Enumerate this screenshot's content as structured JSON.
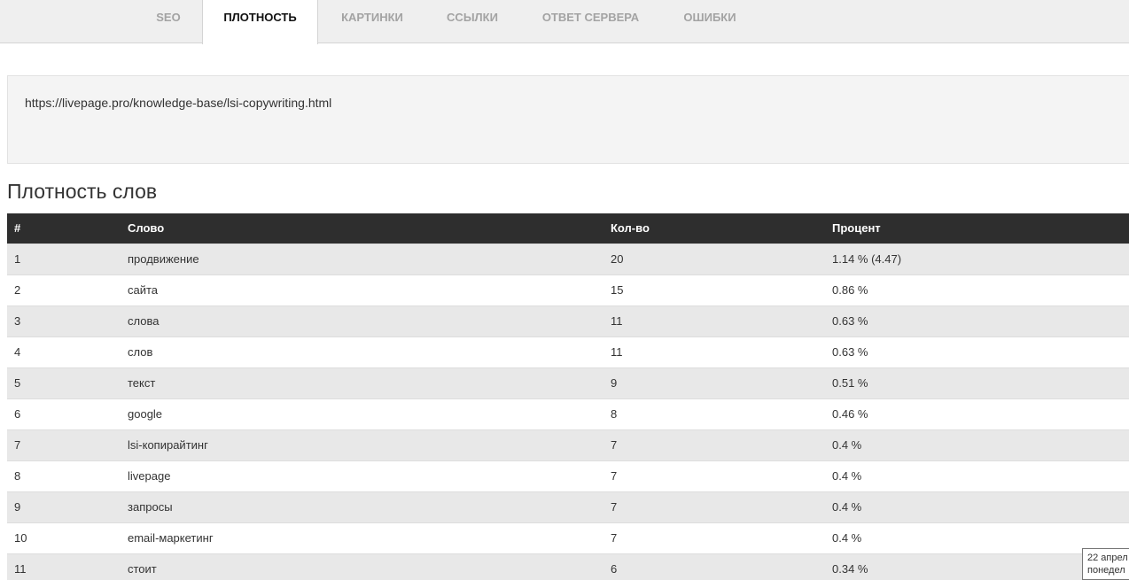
{
  "tabs": [
    {
      "label": "SEO",
      "active": false
    },
    {
      "label": "ПЛОТНОСТЬ",
      "active": true
    },
    {
      "label": "КАРТИНКИ",
      "active": false
    },
    {
      "label": "ССЫЛКИ",
      "active": false
    },
    {
      "label": "ОТВЕТ СЕРВЕРА",
      "active": false
    },
    {
      "label": "ОШИБКИ",
      "active": false
    }
  ],
  "url": "https://livepage.pro/knowledge-base/lsi-copywriting.html",
  "section_title": "Плотность слов",
  "table": {
    "headers": [
      "#",
      "Слово",
      "Кол-во",
      "Процент"
    ],
    "rows": [
      [
        "1",
        "продвижение",
        "20",
        "1.14 % (4.47)"
      ],
      [
        "2",
        "сайта",
        "15",
        "0.86 %"
      ],
      [
        "3",
        "слова",
        "11",
        "0.63 %"
      ],
      [
        "4",
        "слов",
        "11",
        "0.63 %"
      ],
      [
        "5",
        "текст",
        "9",
        "0.51 %"
      ],
      [
        "6",
        "google",
        "8",
        "0.46 %"
      ],
      [
        "7",
        "lsi-копирайтинг",
        "7",
        "0.4 %"
      ],
      [
        "8",
        "livepage",
        "7",
        "0.4 %"
      ],
      [
        "9",
        "запросы",
        "7",
        "0.4 %"
      ],
      [
        "10",
        "email-маркетинг",
        "7",
        "0.4 %"
      ],
      [
        "11",
        "стоит",
        "6",
        "0.34 %"
      ]
    ]
  },
  "tooltip": {
    "line1": "22 апрел",
    "line2": "понедел"
  },
  "colors": {
    "header_bg": "#2e2e2e",
    "row_odd": "#e8e8e8",
    "tabbar_bg": "#efefef"
  }
}
